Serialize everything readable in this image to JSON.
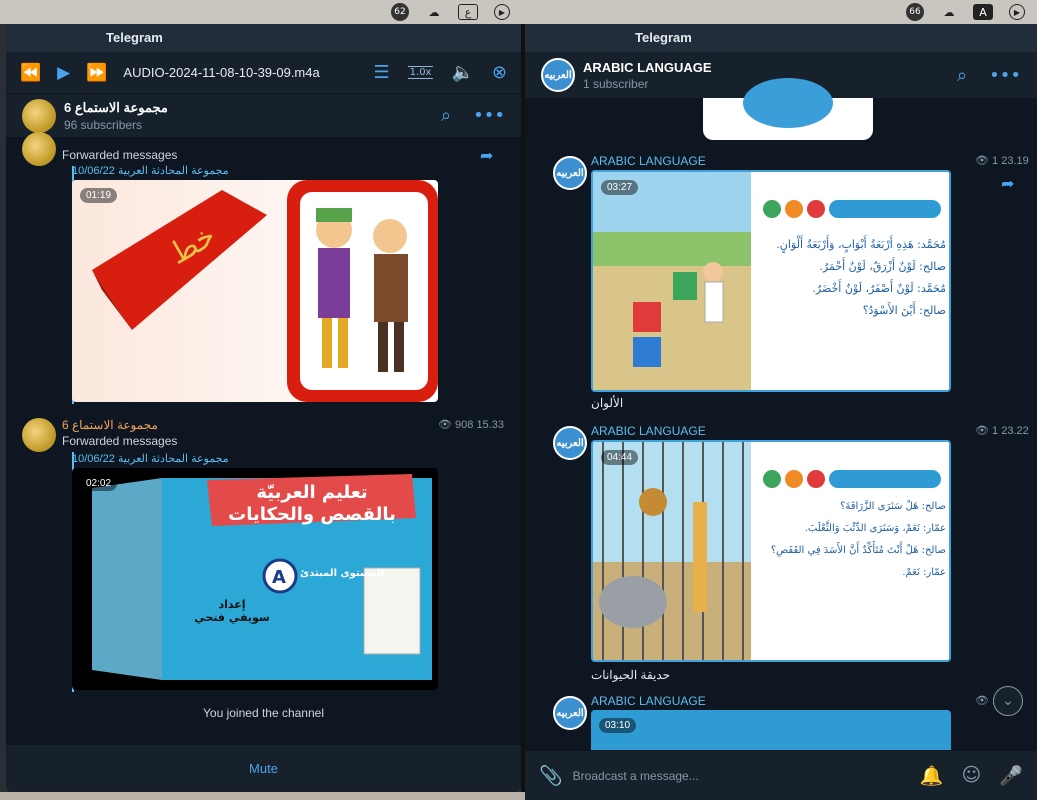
{
  "menubar_left": {
    "badge": "62",
    "box": "ع"
  },
  "menubar_right": {
    "badge": "66",
    "box": "A"
  },
  "left": {
    "app_title": "Telegram",
    "player": {
      "title": "AUDIO-2024-11-08-10-39-09.m4a",
      "speed": "1.0x"
    },
    "chat": {
      "name": "مجموعة الاستماع 6",
      "subscribers": "96 subscribers"
    },
    "msg1": {
      "forwarded": "Forwarded messages",
      "fwd_from": "مجموعة المحادثة العربية 10/06/22",
      "duration": "01:19"
    },
    "msg2": {
      "sender": "مجموعة الاستماع 6",
      "forwarded": "Forwarded messages",
      "views": "908 15.33",
      "fwd_from": "مجموعة المحادثة العربية 10/06/22",
      "duration": "02:02",
      "banner1": "تعليم العربيّة",
      "banner2": "بالقصص والحكايات",
      "level": "المستوى المبتدئ",
      "author1": "إعداد",
      "author2": "سويفي فتحي"
    },
    "joined": "You joined the channel",
    "mute": "Mute"
  },
  "right": {
    "app_title": "Telegram",
    "chat": {
      "name": "ARABIC LANGUAGE",
      "subscribers": "1 subscriber",
      "avatar_text": "العربيه"
    },
    "posts": [
      {
        "sender": "ARABIC LANGUAGE",
        "views": "1 23.19",
        "duration": "03:27",
        "caption": "الألوان",
        "lines": [
          "مُحَمَّد: هَذِهِ أَرْبَعَةُ أَبْوَابٍ، وَأَرْبَعَةُ أَلْوَانٍ.",
          "صالح: لَوْنٌ أَزْرَقُ، لَوْنٌ أَحْمَرُ.",
          "مُحَمَّد: لَوْنٌ أَصْفَرُ، لَوْنٌ أَخْضَرُ.",
          "صالح: أَيْنَ الأَسْوَدُ؟"
        ]
      },
      {
        "sender": "ARABIC LANGUAGE",
        "views": "1 23.22",
        "duration": "04:44",
        "caption": "حديقة الحيوانات",
        "lines": [
          "صالح: هَلْ سَنَرَى الزَّرَافَةَ؟",
          "عمّار: نَعَمْ، وَسَنَرَى الدِّئْبَ وَالثَّعْلَبَ.",
          "صالح: هَلْ أَنْتَ مُتَأَكِّدٌ أَنَّ الأَسَدَ فِي القَفَصِ؟",
          "عمّار: نَعَمْ."
        ]
      },
      {
        "sender": "ARABIC LANGUAGE",
        "views": "1",
        "duration": "03:10"
      }
    ],
    "compose_placeholder": "Broadcast a message..."
  }
}
